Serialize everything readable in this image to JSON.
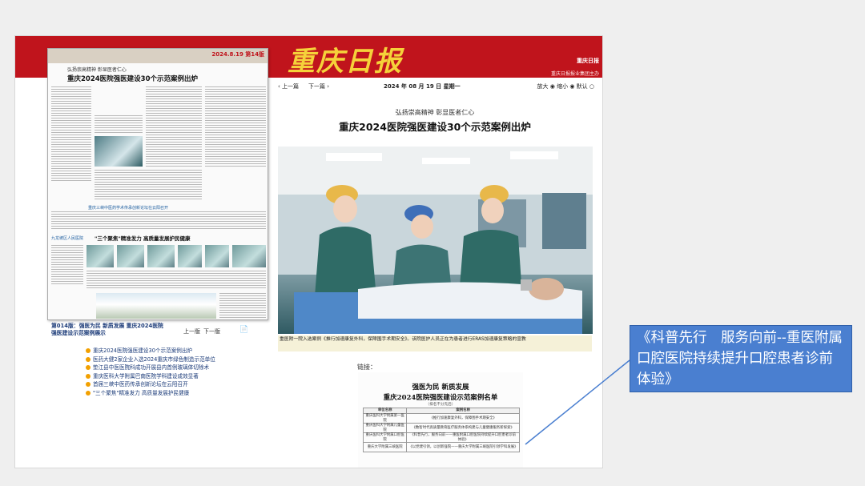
{
  "newspaper": {
    "logo": "重庆日报",
    "brand_name": "重庆日报",
    "brand_sub": "重庆日报报业集团主办",
    "nav": {
      "prev": "‹ 上一篇",
      "next": "下一篇 ›"
    },
    "date": "2024 年 08 月 19 日  星期一",
    "zoom": "放大 ◉  缩小 ◉  默认 ○"
  },
  "paper_thumb": {
    "page_label": "2024.8.19 第14版",
    "kicker": "弘扬崇高精神  彰显医者仁心",
    "headline": "重庆2024医院强医建设30个示范案例出炉",
    "sub1_kicker": "重庆三峡中医药学术传承创新论坛在云阳召开",
    "sub2_kicker": "九龙坡区人民医院",
    "sub2_head": "\"三个聚焦\"精准发力  高质量发展护民健康"
  },
  "article": {
    "kicker": "弘扬崇高精神  彰显医者仁心",
    "title": "重庆2024医院强医建设30个示范案例出炉",
    "caption": "重医附一院入选案例《推行加速康复外科，保障围手术期安全》。该院医护人员正在为患者进行ERAS加速康复策略的宣教"
  },
  "page_nav": {
    "page_title": "第014版：强医为民 新质发展 重庆2024医院强医建设示范案例展示",
    "prev": "上一版",
    "next": "下一版",
    "pdf_icon": "pdf-icon"
  },
  "article_list": [
    "重庆2024医院强医建设30个示范案例出炉",
    "医药大健2家企业入选2024重庆市绿色制造示范单位",
    "垫江县中医医院科成功开展县内首例玻璃体切除术",
    "重庆医科大学附属巴南医院学科建设成效显著",
    "首届三峡中医药传承创新论坛在云阳召开",
    "\"三个聚焦\"精准发力 高质量发展护民健康"
  ],
  "link_section": {
    "label": "链接：",
    "kicker": "强医为民  新质发展",
    "title": "重庆2024医院强医建设示范案例名单",
    "note": "（排名不分先后）",
    "headers": [
      "单位名称",
      "案例名称"
    ],
    "rows": [
      [
        "重庆医科大学附属第一医院",
        "《推行加速康复外科，保障围手术期安全》"
      ],
      [
        "重庆医科大学附属儿童医院",
        "《数智时代高质量教育医疗服务体系构建与儿童健康服务新探索》"
      ],
      [
        "重庆医科大学附属口腔医院",
        "《科普先行，服务向前——重医附属口腔医院持续提升口腔患者诊前体验》"
      ],
      [
        "重庆大学附属三峡医院",
        "《以党建引领，以创新强院——重庆大学附属三峡医院引领学科发展》"
      ]
    ]
  },
  "callout": {
    "text": "《科普先行　服务向前--重医附属口腔医院持续提升口腔患者诊前体验》"
  },
  "colors": {
    "banner": "#c0141c",
    "logo": "#f5d23a",
    "link_blue": "#1a3a78",
    "callout_bg": "#4a7fd0",
    "highlight": "#e01515"
  }
}
